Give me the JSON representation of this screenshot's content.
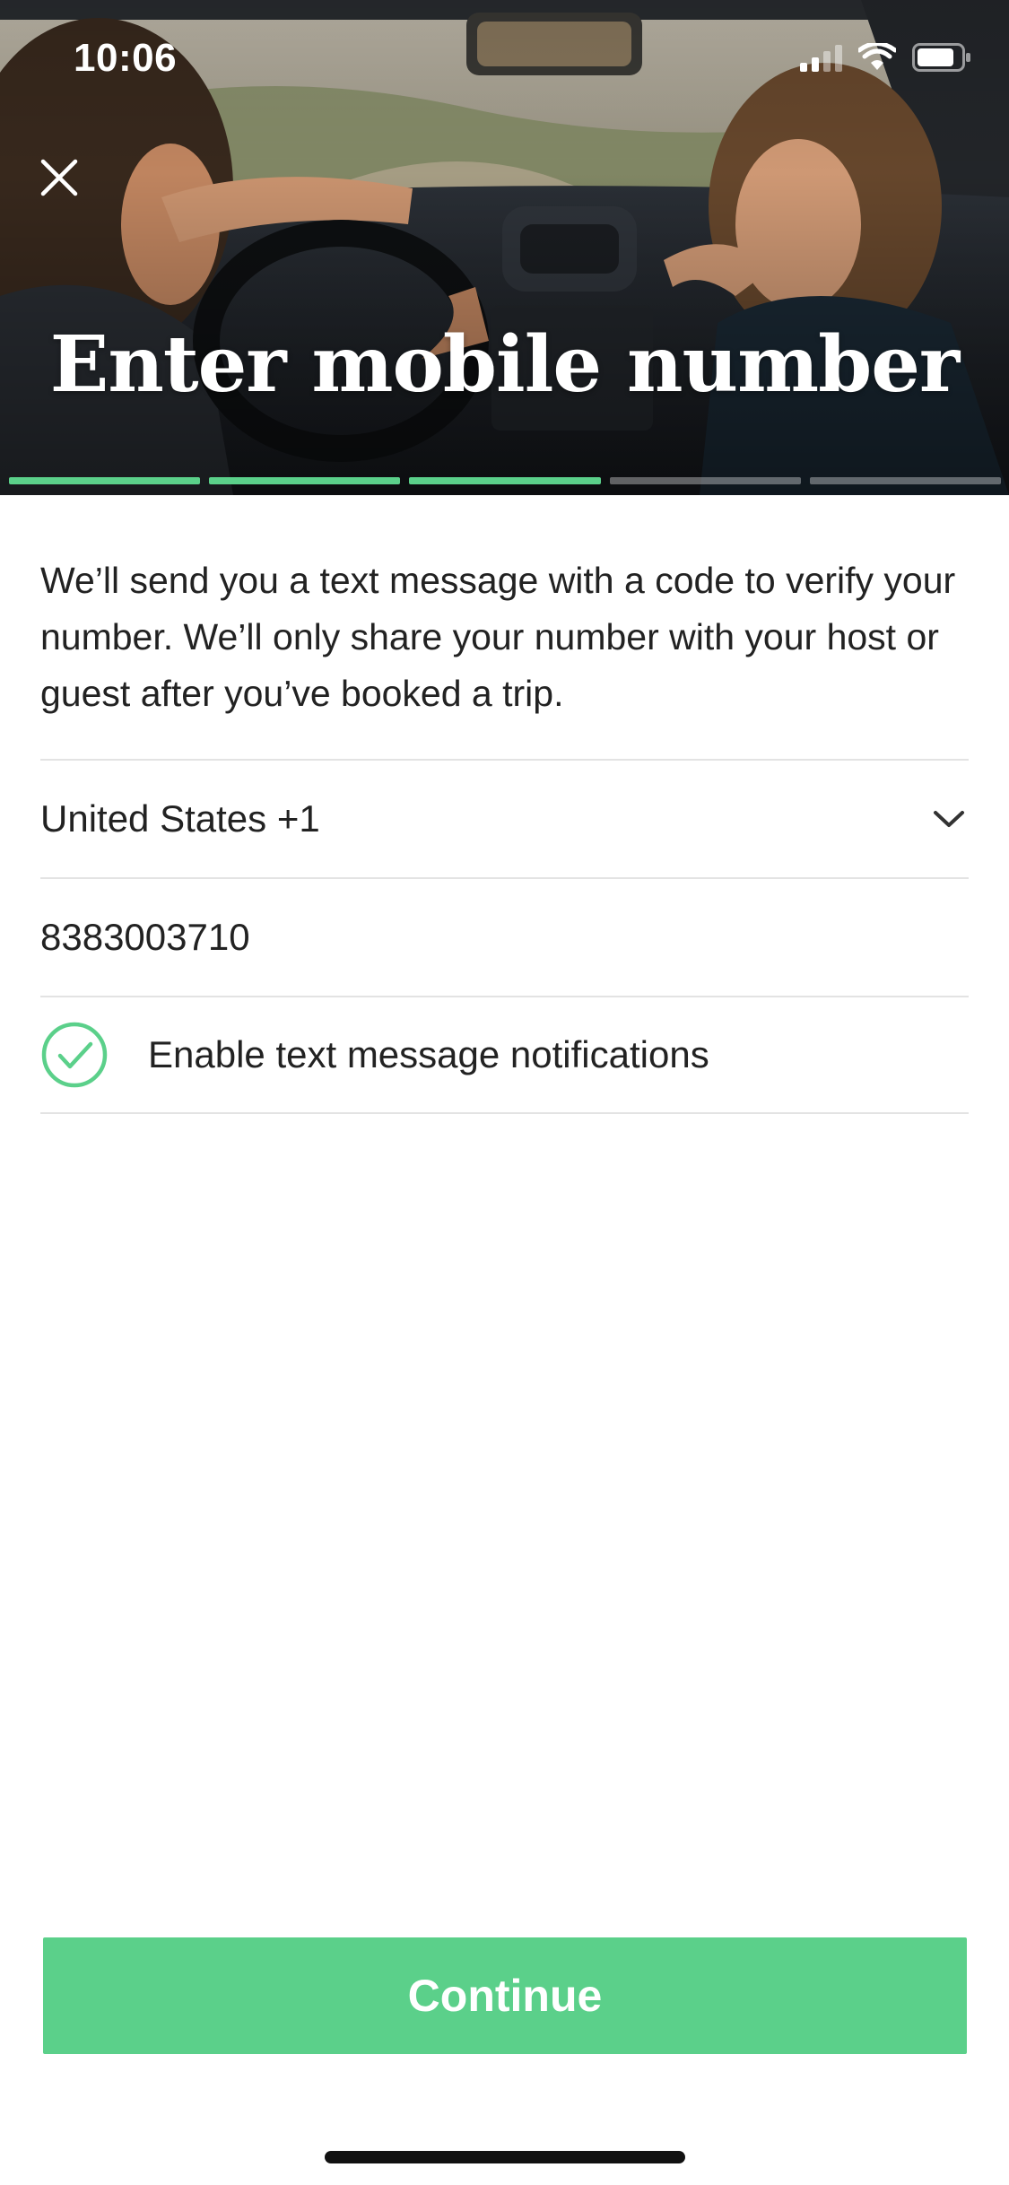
{
  "status_bar": {
    "time": "10:06",
    "icons": [
      "cellular-signal-icon",
      "wifi-icon",
      "battery-icon"
    ]
  },
  "header": {
    "title": "Enter mobile number",
    "close_icon": "close-icon",
    "progress": {
      "total_steps": 5,
      "completed_steps": 3
    }
  },
  "form": {
    "intro_text": "We’ll send you a text message with a code to verify your number. We’ll only share your number with your host or guest after you’ve booked a trip.",
    "country": "United States +1",
    "phone_number": "8383003710",
    "notifications_label": "Enable text message notifications",
    "notifications_enabled": true
  },
  "actions": {
    "continue_label": "Continue"
  },
  "colors": {
    "accent": "#5bd08a",
    "text": "#222222",
    "divider": "#e3e3e3"
  }
}
